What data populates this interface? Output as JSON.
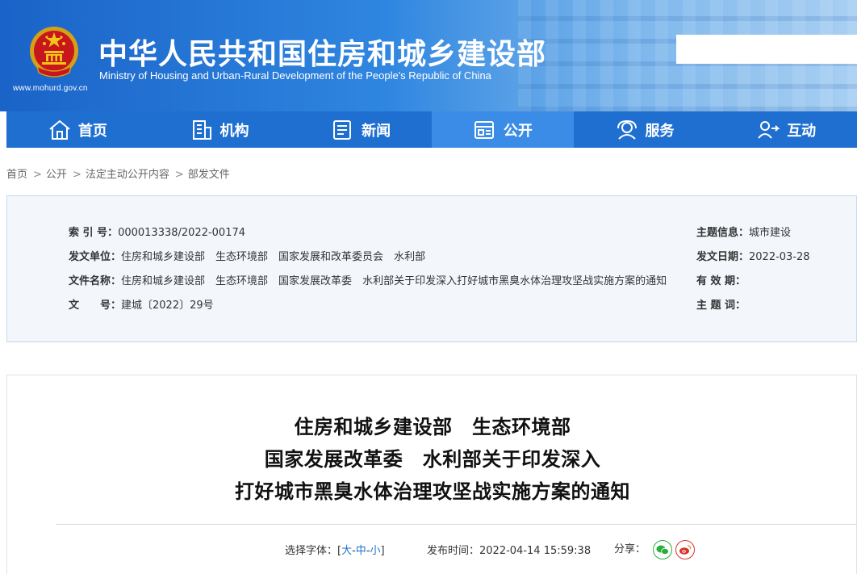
{
  "header": {
    "title_cn": "中华人民共和国住房和城乡建设部",
    "title_en": "Ministry of Housing and Urban-Rural Development of the People's Republic of China",
    "url": "www.mohurd.gov.cn",
    "search_placeholder": ""
  },
  "nav": [
    {
      "label": "首页",
      "icon": "home-icon"
    },
    {
      "label": "机构",
      "icon": "building-icon"
    },
    {
      "label": "新闻",
      "icon": "news-icon"
    },
    {
      "label": "公开",
      "icon": "disclosure-icon"
    },
    {
      "label": "服务",
      "icon": "service-icon"
    },
    {
      "label": "互动",
      "icon": "interact-icon"
    }
  ],
  "breadcrumb": [
    "首页",
    "公开",
    "法定主动公开内容",
    "部发文件"
  ],
  "info": {
    "index_label": "索 引 号：",
    "index_value": "000013338/2022-00174",
    "issuer_label": "发文单位：",
    "issuers": [
      "住房和城乡建设部",
      "生态环境部",
      "国家发展和改革委员会",
      "水利部"
    ],
    "filename_label": "文件名称：",
    "filename_parts": [
      "住房和城乡建设部",
      "生态环境部",
      "国家发展改革委",
      "水利部关于印发深入打好城市黑臭水体治理攻坚战实施方案的通知"
    ],
    "docno_label": "文　　号：",
    "docno_value": "建城〔2022〕29号",
    "topic_label": "主题信息：",
    "topic_value": "城市建设",
    "date_label": "发文日期：",
    "date_value": "2022-03-28",
    "validity_label": "有 效 期：",
    "validity_value": "",
    "keywords_label": "主 题 词：",
    "keywords_value": ""
  },
  "article": {
    "title_lines": [
      "住房和城乡建设部　生态环境部",
      "国家发展改革委　水利部关于印发深入",
      "打好城市黑臭水体治理攻坚战实施方案的通知"
    ],
    "font_label": "选择字体：[",
    "font_large": "大",
    "font_medium": "中",
    "font_small": "小",
    "font_close": "]",
    "dash": "-",
    "publish_label": "发布时间：",
    "publish_time": "2022-04-14 15:59:38",
    "share_label": "分享："
  },
  "colors": {
    "header_start": "#1a63c8",
    "nav_bg": "#1f6fd1",
    "nav_active": "#3b8ce6",
    "wechat": "#2aae3b",
    "weibo": "#d9332c"
  }
}
